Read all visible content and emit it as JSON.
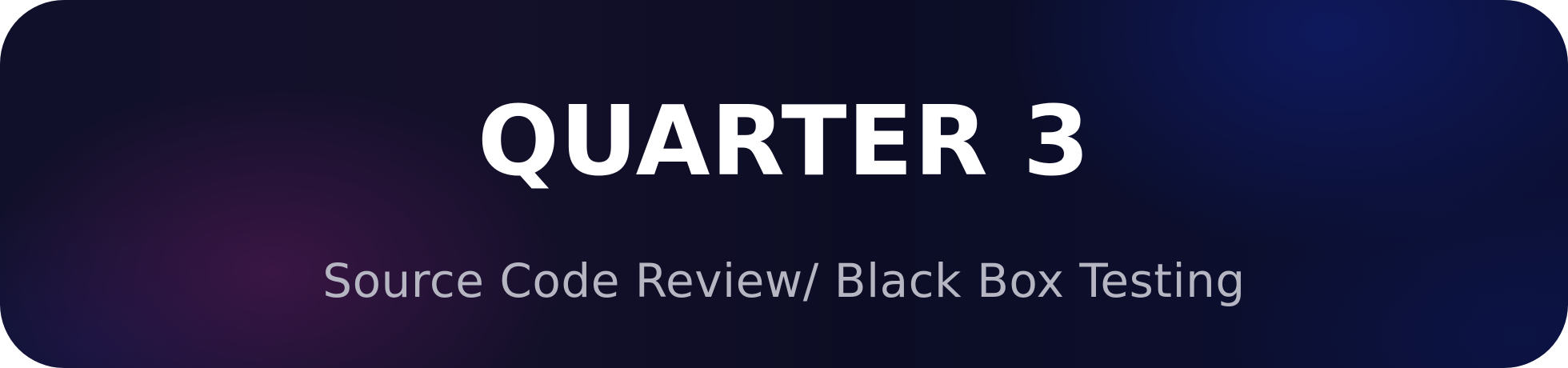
{
  "banner": {
    "title": "QUARTER 3",
    "subtitle": "Source Code Review/ Black Box Testing"
  },
  "colors": {
    "title_text": "#ffffff",
    "subtitle_text": "#b6b6c2",
    "background_dark": "#10102a",
    "accent_purple": "#3c1646",
    "accent_blue": "#0e1a60"
  }
}
